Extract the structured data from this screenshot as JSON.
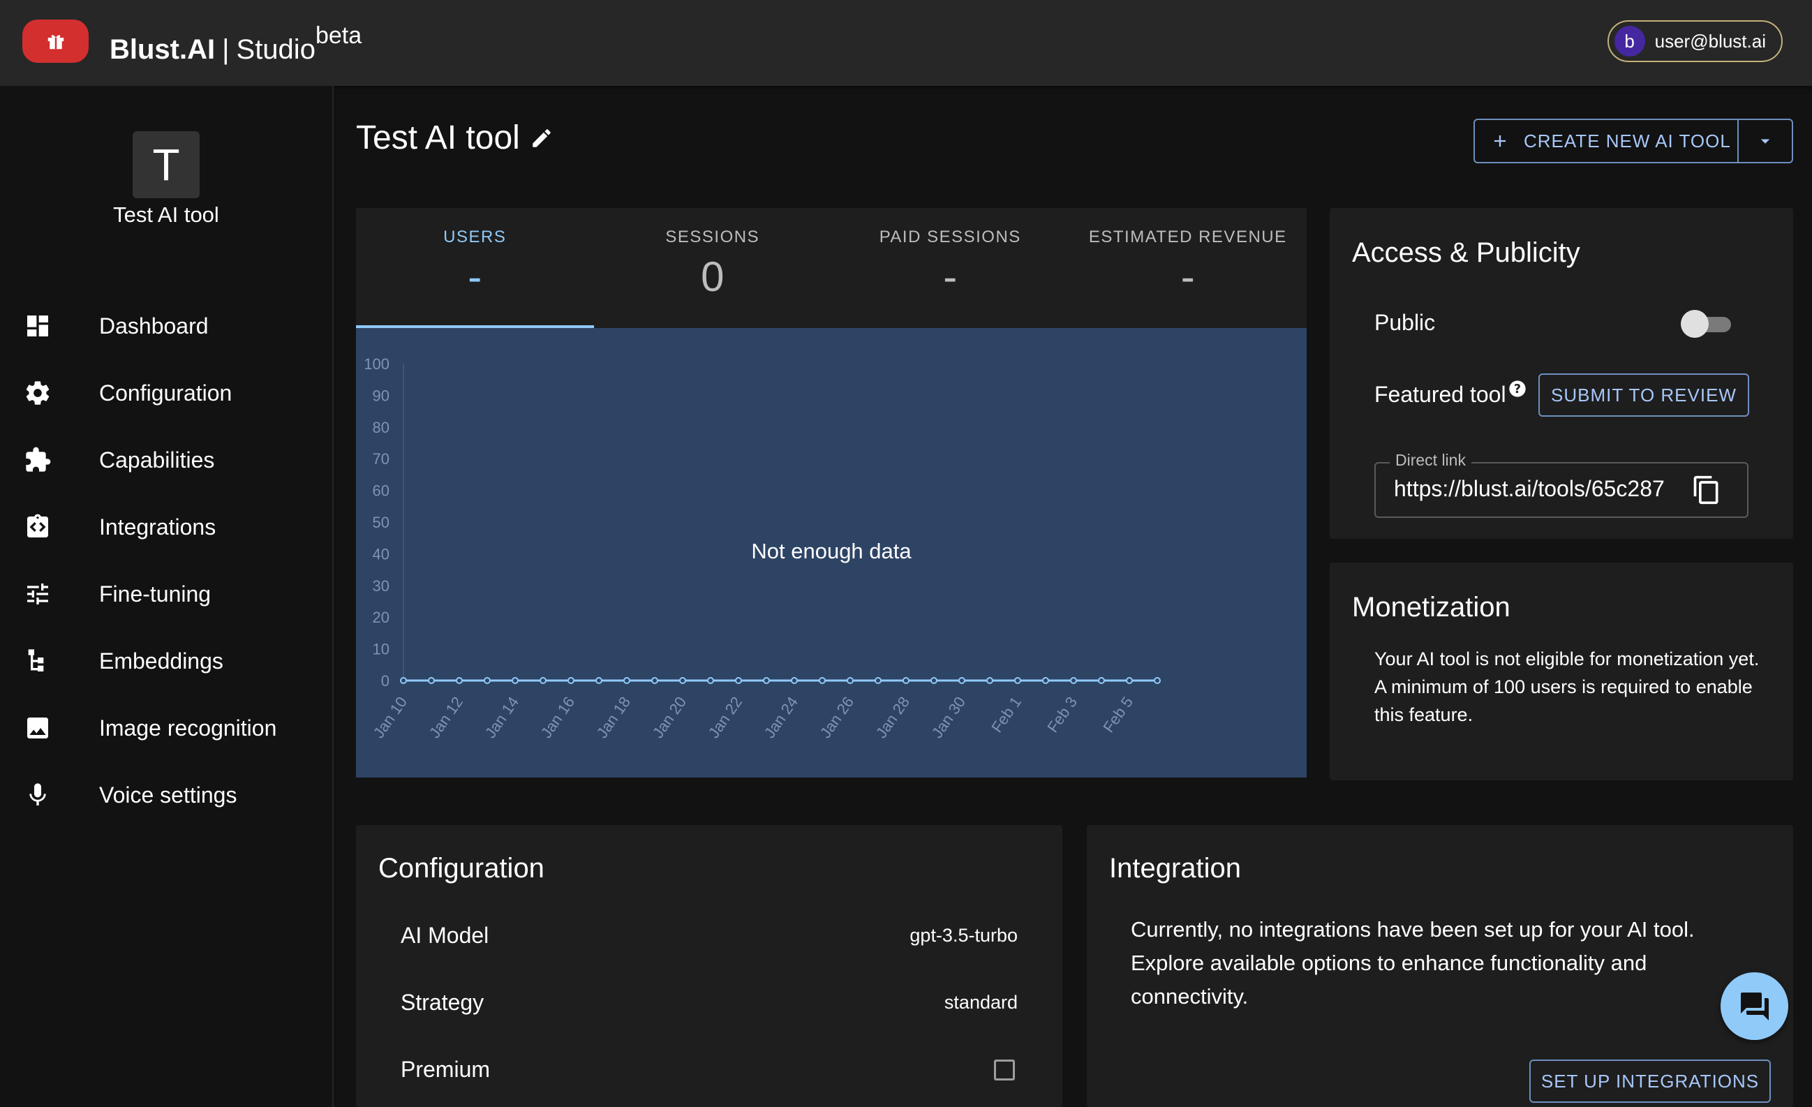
{
  "header": {
    "brand_name": "Blust.AI",
    "brand_sep": "|",
    "brand_product": "Studio",
    "brand_badge": "beta",
    "user_initial": "b",
    "user_email": "user@blust.ai"
  },
  "sidebar": {
    "tool_initial": "T",
    "tool_name": "Test AI tool",
    "items": [
      {
        "label": "Dashboard",
        "icon": "dashboard-icon"
      },
      {
        "label": "Configuration",
        "icon": "gear-icon"
      },
      {
        "label": "Capabilities",
        "icon": "puzzle-icon"
      },
      {
        "label": "Integrations",
        "icon": "integration-icon"
      },
      {
        "label": "Fine-tuning",
        "icon": "tune-icon"
      },
      {
        "label": "Embeddings",
        "icon": "hierarchy-icon"
      },
      {
        "label": "Image recognition",
        "icon": "image-icon"
      },
      {
        "label": "Voice settings",
        "icon": "microphone-icon"
      }
    ]
  },
  "main": {
    "title": "Test AI tool",
    "create_label": "CREATE NEW AI TOOL"
  },
  "stats": {
    "tabs": [
      {
        "label": "USERS",
        "value": "-"
      },
      {
        "label": "SESSIONS",
        "value": "0"
      },
      {
        "label": "PAID SESSIONS",
        "value": "-"
      },
      {
        "label": "ESTIMATED REVENUE",
        "value": "-"
      }
    ]
  },
  "chart_data": {
    "type": "line",
    "empty_message": "Not enough data",
    "x": [
      "Jan 10",
      "Jan 11",
      "Jan 12",
      "Jan 13",
      "Jan 14",
      "Jan 15",
      "Jan 16",
      "Jan 17",
      "Jan 18",
      "Jan 19",
      "Jan 20",
      "Jan 21",
      "Jan 22",
      "Jan 23",
      "Jan 24",
      "Jan 25",
      "Jan 26",
      "Jan 27",
      "Jan 28",
      "Jan 29",
      "Jan 30",
      "Jan 31",
      "Feb 1",
      "Feb 2",
      "Feb 3",
      "Feb 4",
      "Feb 5",
      "Feb 6"
    ],
    "x_tick_labels": [
      "Jan 10",
      "Jan 12",
      "Jan 14",
      "Jan 16",
      "Jan 18",
      "Jan 20",
      "Jan 22",
      "Jan 24",
      "Jan 26",
      "Jan 28",
      "Jan 30",
      "Feb 1",
      "Feb 3",
      "Feb 5"
    ],
    "values": [
      0,
      0,
      0,
      0,
      0,
      0,
      0,
      0,
      0,
      0,
      0,
      0,
      0,
      0,
      0,
      0,
      0,
      0,
      0,
      0,
      0,
      0,
      0,
      0,
      0,
      0,
      0,
      0
    ],
    "ylim": [
      0,
      100
    ],
    "y_ticks": [
      0,
      10,
      20,
      30,
      40,
      50,
      60,
      70,
      80,
      90,
      100
    ],
    "colors": {
      "line": "#90caf9",
      "background": "#2e4465"
    }
  },
  "access": {
    "title": "Access & Publicity",
    "public_label": "Public",
    "public_on": false,
    "featured_label": "Featured tool",
    "submit_label": "SUBMIT TO REVIEW",
    "direct_link_label": "Direct link",
    "direct_link_value": "https://blust.ai/tools/65c287"
  },
  "monetization": {
    "title": "Monetization",
    "text": "Your AI tool is not eligible for monetization yet. A minimum of 100 users is required to enable this feature."
  },
  "configuration": {
    "title": "Configuration",
    "rows": [
      {
        "label": "AI Model",
        "value": "gpt-3.5-turbo"
      },
      {
        "label": "Strategy",
        "value": "standard"
      },
      {
        "label": "Premium",
        "checked": false
      }
    ]
  },
  "integration": {
    "title": "Integration",
    "text": "Currently, no integrations have been set up for your AI tool. Explore available options to enhance functionality and connectivity.",
    "button_label": "SET UP INTEGRATIONS"
  },
  "colors": {
    "accent": "#90caf9",
    "brand": "#d32f2f",
    "surface": "#1e1e1e",
    "background": "#121212"
  }
}
